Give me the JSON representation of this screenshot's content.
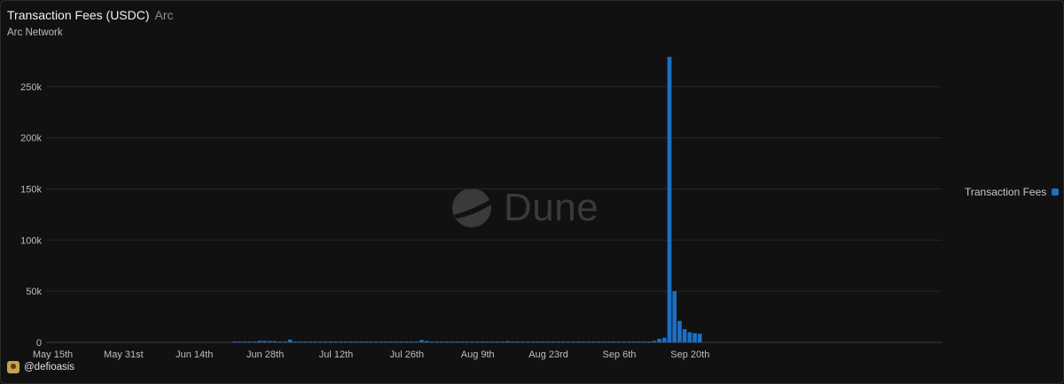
{
  "header": {
    "title": "Transaction Fees (USDC)",
    "tag": "Arc",
    "subtitle": "Arc Network"
  },
  "legend": {
    "label": "Transaction Fees",
    "color": "#1d6fc4"
  },
  "watermark": {
    "text": "Dune"
  },
  "attribution": {
    "handle": "@defioasis"
  },
  "chart_data": {
    "type": "bar",
    "title": "Transaction Fees (USDC)",
    "xlabel": "",
    "ylabel": "",
    "x_ticks": [
      "May 15th",
      "May 31st",
      "Jun 14th",
      "Jun 28th",
      "Jul 12th",
      "Jul 26th",
      "Aug 9th",
      "Aug 23rd",
      "Sep 6th",
      "Sep 20th"
    ],
    "y_ticks": [
      "0",
      "50k",
      "100k",
      "150k",
      "200k",
      "250k"
    ],
    "ylim": [
      0,
      300000
    ],
    "grid": "horizontal",
    "legend_position": "right",
    "series": [
      {
        "name": "Transaction Fees",
        "color": "#1d6fc4",
        "points": [
          [
            "2025-06-20",
            300
          ],
          [
            "2025-06-21",
            350
          ],
          [
            "2025-06-22",
            400
          ],
          [
            "2025-06-23",
            600
          ],
          [
            "2025-06-24",
            900
          ],
          [
            "2025-06-25",
            1500
          ],
          [
            "2025-06-26",
            1500
          ],
          [
            "2025-06-27",
            1300
          ],
          [
            "2025-06-28",
            1200
          ],
          [
            "2025-06-29",
            800
          ],
          [
            "2025-06-30",
            600
          ],
          [
            "2025-07-01",
            2800
          ],
          [
            "2025-07-02",
            700
          ],
          [
            "2025-07-03",
            500
          ],
          [
            "2025-07-04",
            450
          ],
          [
            "2025-07-05",
            400
          ],
          [
            "2025-07-06",
            400
          ],
          [
            "2025-07-07",
            400
          ],
          [
            "2025-07-08",
            450
          ],
          [
            "2025-07-09",
            400
          ],
          [
            "2025-07-10",
            400
          ],
          [
            "2025-07-11",
            400
          ],
          [
            "2025-07-12",
            450
          ],
          [
            "2025-07-13",
            400
          ],
          [
            "2025-07-14",
            400
          ],
          [
            "2025-07-15",
            500
          ],
          [
            "2025-07-16",
            450
          ],
          [
            "2025-07-17",
            400
          ],
          [
            "2025-07-18",
            400
          ],
          [
            "2025-07-19",
            400
          ],
          [
            "2025-07-20",
            400
          ],
          [
            "2025-07-21",
            400
          ],
          [
            "2025-07-22",
            450
          ],
          [
            "2025-07-23",
            400
          ],
          [
            "2025-07-24",
            400
          ],
          [
            "2025-07-25",
            400
          ],
          [
            "2025-07-26",
            400
          ],
          [
            "2025-07-27",
            2300
          ],
          [
            "2025-07-28",
            1400
          ],
          [
            "2025-07-29",
            600
          ],
          [
            "2025-07-30",
            450
          ],
          [
            "2025-07-31",
            400
          ],
          [
            "2025-08-01",
            400
          ],
          [
            "2025-08-02",
            400
          ],
          [
            "2025-08-03",
            400
          ],
          [
            "2025-08-04",
            400
          ],
          [
            "2025-08-05",
            450
          ],
          [
            "2025-08-06",
            400
          ],
          [
            "2025-08-07",
            400
          ],
          [
            "2025-08-08",
            400
          ],
          [
            "2025-08-09",
            400
          ],
          [
            "2025-08-10",
            400
          ],
          [
            "2025-08-11",
            400
          ],
          [
            "2025-08-12",
            400
          ],
          [
            "2025-08-13",
            1300
          ],
          [
            "2025-08-14",
            600
          ],
          [
            "2025-08-15",
            450
          ],
          [
            "2025-08-16",
            400
          ],
          [
            "2025-08-17",
            400
          ],
          [
            "2025-08-18",
            400
          ],
          [
            "2025-08-19",
            400
          ],
          [
            "2025-08-20",
            400
          ],
          [
            "2025-08-21",
            400
          ],
          [
            "2025-08-22",
            400
          ],
          [
            "2025-08-23",
            400
          ],
          [
            "2025-08-24",
            400
          ],
          [
            "2025-08-25",
            400
          ],
          [
            "2025-08-26",
            400
          ],
          [
            "2025-08-27",
            400
          ],
          [
            "2025-08-28",
            400
          ],
          [
            "2025-08-29",
            400
          ],
          [
            "2025-08-30",
            400
          ],
          [
            "2025-08-31",
            450
          ],
          [
            "2025-09-01",
            450
          ],
          [
            "2025-09-02",
            500
          ],
          [
            "2025-09-03",
            500
          ],
          [
            "2025-09-04",
            500
          ],
          [
            "2025-09-05",
            550
          ],
          [
            "2025-09-06",
            550
          ],
          [
            "2025-09-07",
            550
          ],
          [
            "2025-09-08",
            600
          ],
          [
            "2025-09-09",
            600
          ],
          [
            "2025-09-10",
            700
          ],
          [
            "2025-09-11",
            1500
          ],
          [
            "2025-09-12",
            3500
          ],
          [
            "2025-09-13",
            4500
          ],
          [
            "2025-09-14",
            279000
          ],
          [
            "2025-09-15",
            50000
          ],
          [
            "2025-09-16",
            21000
          ],
          [
            "2025-09-17",
            13000
          ],
          [
            "2025-09-18",
            10000
          ],
          [
            "2025-09-19",
            9000
          ],
          [
            "2025-09-20",
            8500
          ]
        ]
      }
    ]
  }
}
